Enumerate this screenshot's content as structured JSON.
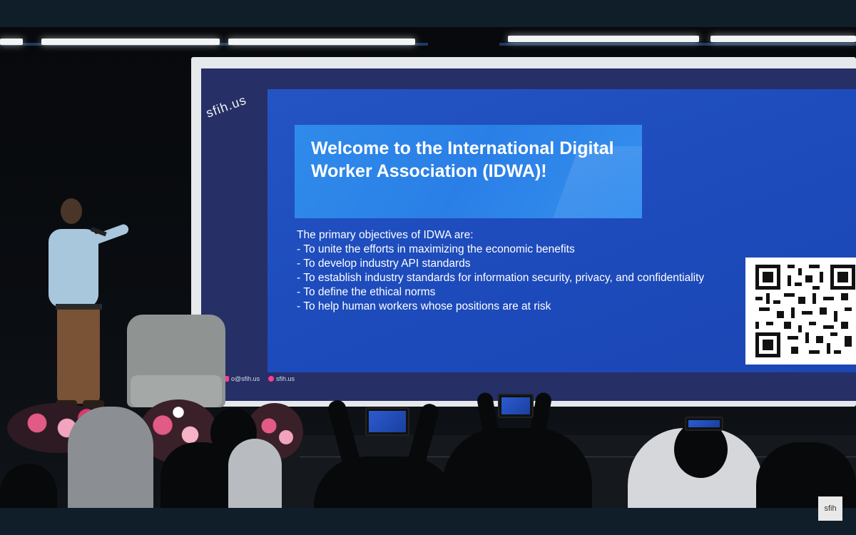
{
  "slide": {
    "title": "Welcome to the International Digital Worker Association (IDWA)!",
    "intro": "The primary objectives of IDWA are:",
    "objectives": [
      "- To unite the efforts in maximizing the economic benefits",
      "- To develop industry API standards",
      "- To establish industry standards for information security, privacy, and confidentiality",
      "- To define the ethical norms",
      "- To help human workers whose positions are at risk"
    ],
    "qr_label": "qr-code"
  },
  "screen_decoration": {
    "text": "sfih.us"
  },
  "social": {
    "email": "o@sfih.us",
    "instagram": "sfih.us"
  },
  "watermark": {
    "text": "sfih"
  },
  "colors": {
    "slide_background": "#1e4cbd",
    "title_box": "#2f8bea",
    "accent_pink": "#ff3d8b"
  }
}
